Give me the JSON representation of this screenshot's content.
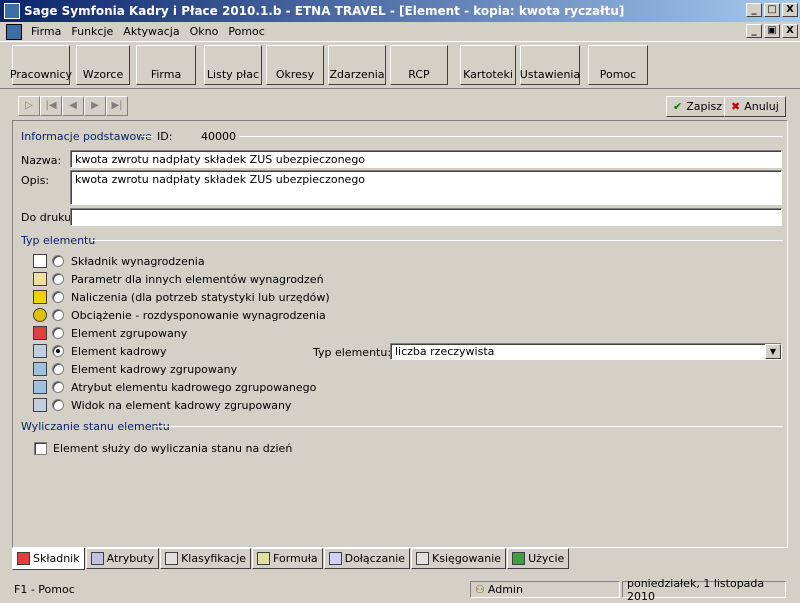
{
  "window": {
    "title": "Sage Symfonia Kadry i Płace 2010.1.b - ETNA TRAVEL - [Element - kopia: kwota ryczałtu]",
    "btn_minimize": "_",
    "btn_maximize": "□",
    "btn_close": "X",
    "mdi_minimize": "_",
    "mdi_restore": "▣",
    "mdi_close": "X"
  },
  "menu": [
    "Firma",
    "Funkcje",
    "Aktywacja",
    "Okno",
    "Pomoc"
  ],
  "toolbar": [
    {
      "label": "Pracownicy",
      "icon": "employees-icon",
      "color": "#e8b400"
    },
    {
      "label": "Wzorce",
      "icon": "templates-icon",
      "color": "#c08020"
    },
    {
      "label": "Firma",
      "icon": "globe-icon",
      "color": "#2a7fd0"
    },
    {
      "label": "Listy płac",
      "icon": "payroll-icon",
      "color": "#d0a000"
    },
    {
      "label": "Okresy",
      "icon": "periods-icon",
      "color": "#4060a0"
    },
    {
      "label": "Zdarzenia",
      "icon": "events-icon",
      "color": "#1040c0"
    },
    {
      "label": "RCP",
      "icon": "rcp-icon",
      "color": "#20a040"
    },
    {
      "label": "Kartoteki",
      "icon": "files-icon",
      "color": "#c02020"
    },
    {
      "label": "Ustawienia",
      "icon": "settings-icon",
      "color": "#808080"
    },
    {
      "label": "Pomoc",
      "icon": "help-icon",
      "color": "#f0e000"
    }
  ],
  "actions": {
    "save": "Zapisz",
    "cancel": "Anuluj"
  },
  "basic": {
    "section": "Informacje podstawowe",
    "id_label": "ID:",
    "id_value": "40000",
    "name_label": "Nazwa:",
    "name_value": "kwota zwrotu nadpłaty składek ZUS ubezpieczonego",
    "desc_label": "Opis:",
    "desc_value": "kwota zwrotu nadpłaty składek ZUS ubezpieczonego",
    "print_label": "Do druku:",
    "print_value": ""
  },
  "element_type": {
    "section": "Typ elementu",
    "options": [
      {
        "label": "Składnik wynagrodzenia",
        "icon": "salary-component-icon",
        "selected": false
      },
      {
        "label": "Parametr dla innych elementów wynagrodzeń",
        "icon": "parameter-icon",
        "selected": false
      },
      {
        "label": "Naliczenia (dla potrzeb statystyki lub urzędów)",
        "icon": "calculation-icon",
        "selected": false
      },
      {
        "label": "Obciążenie - rozdysponowanie wynagrodzenia",
        "icon": "charge-icon",
        "selected": false
      },
      {
        "label": "Element zgrupowany",
        "icon": "group-icon",
        "selected": false
      },
      {
        "label": "Element kadrowy",
        "icon": "hr-element-icon",
        "selected": true
      },
      {
        "label": "Element kadrowy zgrupowany",
        "icon": "hr-group-icon",
        "selected": false
      },
      {
        "label": "Atrybut elementu kadrowego zgrupowanego",
        "icon": "attribute-icon",
        "selected": false
      },
      {
        "label": "Widok na element kadrowy zgrupowany",
        "icon": "view-icon",
        "selected": false
      }
    ],
    "type_label": "Typ elementu:",
    "type_value": "liczba rzeczywista"
  },
  "calc": {
    "section": "Wyliczanie stanu elementu",
    "checkbox_label": "Element służy do wyliczania stanu na dzień",
    "checked": false
  },
  "tabs": [
    {
      "label": "Składnik",
      "icon": "component-tab-icon",
      "active": true
    },
    {
      "label": "Atrybuty",
      "icon": "attributes-tab-icon",
      "active": false
    },
    {
      "label": "Klasyfikacje",
      "icon": "classification-tab-icon",
      "active": false
    },
    {
      "label": "Formuła",
      "icon": "formula-tab-icon",
      "active": false
    },
    {
      "label": "Dołączanie",
      "icon": "attach-tab-icon",
      "active": false
    },
    {
      "label": "Księgowanie",
      "icon": "accounting-tab-icon",
      "active": false
    },
    {
      "label": "Użycie",
      "icon": "usage-tab-icon",
      "active": false
    }
  ],
  "status": {
    "help": "F1 - Pomoc",
    "user": "Admin",
    "date": "poniedziałek, 1 listopada 2010"
  }
}
